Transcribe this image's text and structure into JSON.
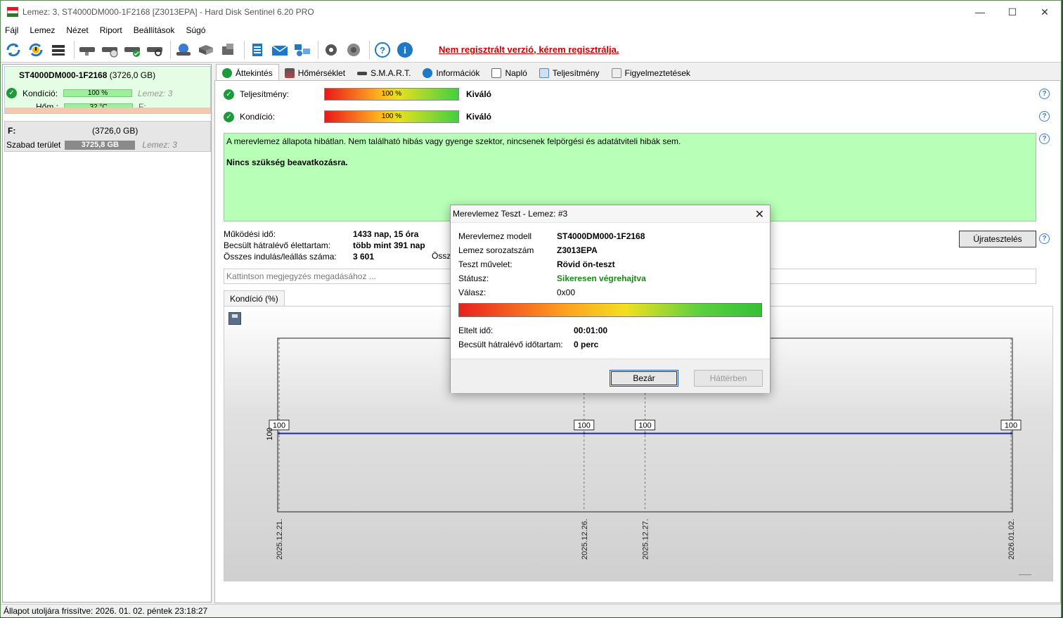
{
  "window": {
    "title": "Lemez: 3, ST4000DM000-1F2168 [Z3013EPA]  -  Hard Disk Sentinel 6.20 PRO",
    "controls": [
      "—",
      "☐",
      "✕"
    ]
  },
  "menu": [
    "Fájl",
    "Lemez",
    "Nézet",
    "Riport",
    "Beállítások",
    "Súgó"
  ],
  "toolbar": {
    "icons": [
      "refresh-icon",
      "refresh-warning-icon",
      "disk-list-icon",
      "disk-icon",
      "disk-clock-icon",
      "disk-check-icon",
      "disk-search-icon",
      "network-disk-icon",
      "disk-tool-icon",
      "disk-box-icon",
      "report-icon",
      "mail-icon",
      "network-icon",
      "settings-icon",
      "sound-icon",
      "help-icon",
      "info-icon"
    ],
    "registration_link": "Nem regisztrált verzió, kérem regisztrálja."
  },
  "left_pane": {
    "disk": {
      "name": "ST4000DM000-1F2168",
      "size": "(3726,0 GB)",
      "condition_label": "Kondíció:",
      "condition_value": "100 %",
      "condition_right": "Lemez: 3",
      "temp_label": "Hőm.:",
      "temp_value": "32 °C",
      "temp_right": "F:"
    },
    "partition": {
      "letter": "F:",
      "size": "(3726,0 GB)",
      "free_label": "Szabad terület",
      "free_value": "3725,8 GB",
      "disk_ref": "Lemez: 3"
    }
  },
  "tabs": [
    "Áttekintés",
    "Hőmérséklet",
    "S.M.A.R.T.",
    "Információk",
    "Napló",
    "Teljesítmény",
    "Figyelmeztetések"
  ],
  "overview": {
    "performance": {
      "label": "Teljesítmény:",
      "value": "100 %",
      "rating": "Kiváló"
    },
    "condition": {
      "label": "Kondíció:",
      "value": "100 %",
      "rating": "Kiváló"
    },
    "status_text": "A merevlemez állapota hibátlan. Nem található hibás vagy gyenge szektor, nincsenek felpörgési és adatátviteli hibák sem.",
    "status_action": "Nincs szükség beavatkozásra.",
    "info": [
      {
        "label": "Működési idő:",
        "value": "1433 nap, 15 óra"
      },
      {
        "label": "Becsült hátralévő élettartam:",
        "value": "több mint 391 nap"
      },
      {
        "label": "Összes indulás/leállás száma:",
        "value": "3 601"
      }
    ],
    "clipped_label": "Össze",
    "retest_button": "Újratesztelés",
    "note_placeholder": "Kattintson megjegyzés megadásához ...",
    "chart_tab": "Kondíció  (%)"
  },
  "chart_data": {
    "type": "line",
    "x": [
      "2025.12.21.",
      "2025.12.26.",
      "2025.12.27.",
      "2026.01.02."
    ],
    "series": [
      {
        "values": [
          100,
          100,
          100,
          100
        ]
      }
    ],
    "data_labels": [
      "100",
      "100",
      "100",
      "100"
    ],
    "ytick": "100",
    "color": "#1c2aa8"
  },
  "dialog": {
    "title": "Merevlemez Teszt - Lemez: #3",
    "rows": [
      {
        "label": "Merevlemez modell",
        "value": "ST4000DM000-1F2168"
      },
      {
        "label": "Lemez sorozatszám",
        "value": "Z3013EPA"
      },
      {
        "label": "Teszt művelet:",
        "value": "Rövid ön-teszt"
      },
      {
        "label": "Státusz:",
        "value": "Sikeresen végrehajtva"
      },
      {
        "label": "Válasz:",
        "value": "0x00"
      }
    ],
    "progress": 1.0,
    "elapsed_label": "Eltelt idő:",
    "elapsed_value": "00:01:00",
    "remaining_label": "Becsült hátralévő időtartam:",
    "remaining_value": "0 perc",
    "close_button": "Bezár",
    "background_button": "Háttérben"
  },
  "statusbar": "Állapot utoljára frissítve: 2026. 01. 02. péntek 23:18:27"
}
